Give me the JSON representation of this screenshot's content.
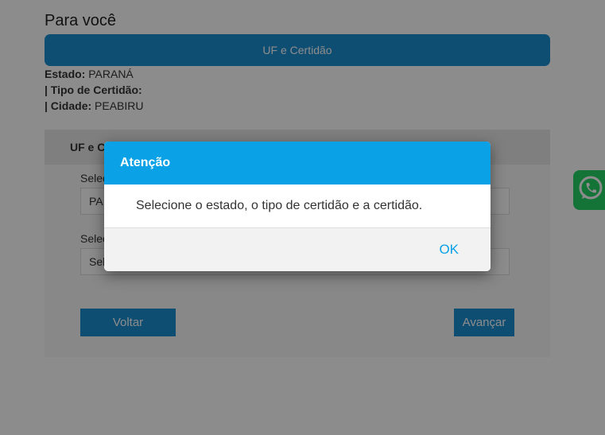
{
  "page": {
    "title": "Para você",
    "step_label": "UF e Certidão",
    "info": {
      "estado_label": "Estado:",
      "estado_value": "PARANÁ",
      "tipo_label": "| Tipo de Certidão:",
      "tipo_value": "",
      "cidade_label": "| Cidade:",
      "cidade_value": "PEABIRU"
    }
  },
  "form": {
    "header": "UF e C",
    "field1_label": "Selec",
    "field1_value": "PA",
    "field2_label": "Selec",
    "field2_value": "Sel",
    "back_label": "Voltar",
    "next_label": "Avançar"
  },
  "modal": {
    "title": "Atenção",
    "message": "Selecione o estado, o tipo de certidão e a certidão.",
    "ok_label": "OK"
  },
  "colors": {
    "primary": "#1d8fd1",
    "modal_header": "#0ba1e6",
    "whatsapp": "#25d366"
  },
  "icons": {
    "whatsapp": "whatsapp-icon"
  }
}
